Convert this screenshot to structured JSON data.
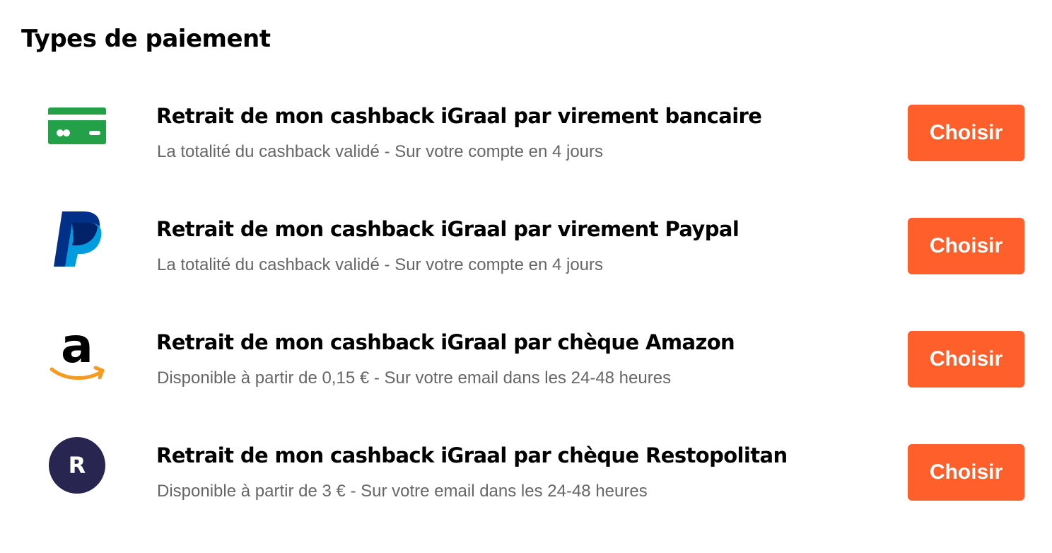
{
  "page": {
    "title": "Types de paiement"
  },
  "colors": {
    "accent": "#ff5f2b",
    "bank_green": "#23a048",
    "paypal_dark": "#003087",
    "paypal_light": "#009cde",
    "amazon_orange": "#f79a1e",
    "restopolitan_navy": "#282650",
    "subtitle_gray": "#666666"
  },
  "payment_methods": [
    {
      "icon": "bank-card-icon",
      "title": "Retrait de mon cashback iGraal par virement bancaire",
      "subtitle": "La totalité du cashback validé - Sur votre compte en 4 jours",
      "button_label": "Choisir"
    },
    {
      "icon": "paypal-logo-icon",
      "title": "Retrait de mon cashback iGraal par virement Paypal",
      "subtitle": "La totalité du cashback validé - Sur votre compte en 4 jours",
      "button_label": "Choisir"
    },
    {
      "icon": "amazon-logo-icon",
      "title": "Retrait de mon cashback iGraal par chèque Amazon",
      "subtitle": "Disponible à partir de 0,15 € - Sur votre email dans les 24-48 heures",
      "button_label": "Choisir"
    },
    {
      "icon": "restopolitan-logo-icon",
      "icon_letter": "R",
      "title": "Retrait de mon cashback iGraal par chèque Restopolitan",
      "subtitle": "Disponible à partir de 3 € - Sur votre email dans les 24-48 heures",
      "button_label": "Choisir"
    }
  ]
}
